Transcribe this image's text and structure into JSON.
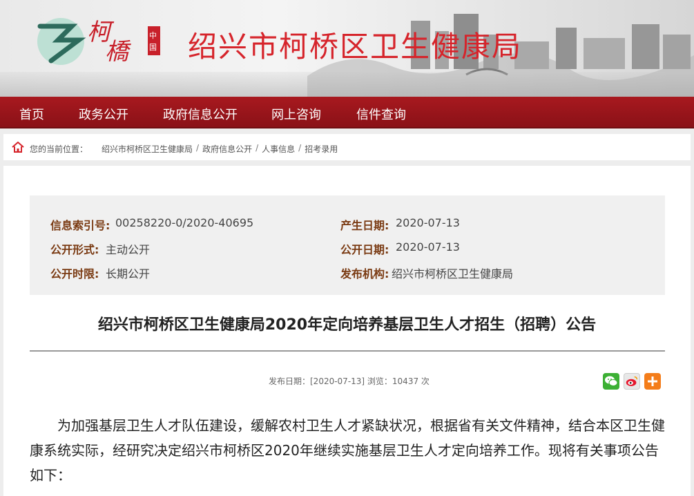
{
  "header": {
    "logo_text": "柯橋",
    "logo_seal": "中国",
    "site_title": "绍兴市柯桥区卫生健康局"
  },
  "nav": {
    "items": [
      "首页",
      "政务公开",
      "政府信息公开",
      "网上咨询",
      "信件查询"
    ]
  },
  "breadcrumb": {
    "prefix": "您的当前位置：",
    "items": [
      "绍兴市柯桥区卫生健康局",
      "政府信息公开",
      "人事信息",
      "招考录用"
    ],
    "separator": "/"
  },
  "meta": {
    "index_label": "信息索引号:",
    "index_value": "00258220-0/2020-40695",
    "created_label": "产生日期:",
    "created_value": "2020-07-13",
    "form_label": "公开形式:",
    "form_value": "主动公开",
    "open_date_label": "公开日期:",
    "open_date_value": "2020-07-13",
    "period_label": "公开时限:",
    "period_value": "长期公开",
    "org_label": "发布机构:",
    "org_value": "绍兴市柯桥区卫生健康局"
  },
  "article": {
    "title": "绍兴市柯桥区卫生健康局2020年定向培养基层卫生人才招生（招聘）公告",
    "pub_info": "发布日期：[2020-07-13] 浏览：10437 次",
    "body": "为加强基层卫生人才队伍建设，缓解农村卫生人才紧缺状况，根据省有关文件精神，结合本区卫生健康系统实际，经研究决定绍兴市柯桥区2020年继续实施基层卫生人才定向培养工作。现将有关事项公告如下："
  },
  "share": {
    "icons": [
      "wechat-icon",
      "weibo-icon",
      "plus-icon"
    ]
  },
  "colors": {
    "nav_bg": "#9c161c",
    "title_red": "#d6242b",
    "meta_label": "#7a3a12"
  }
}
